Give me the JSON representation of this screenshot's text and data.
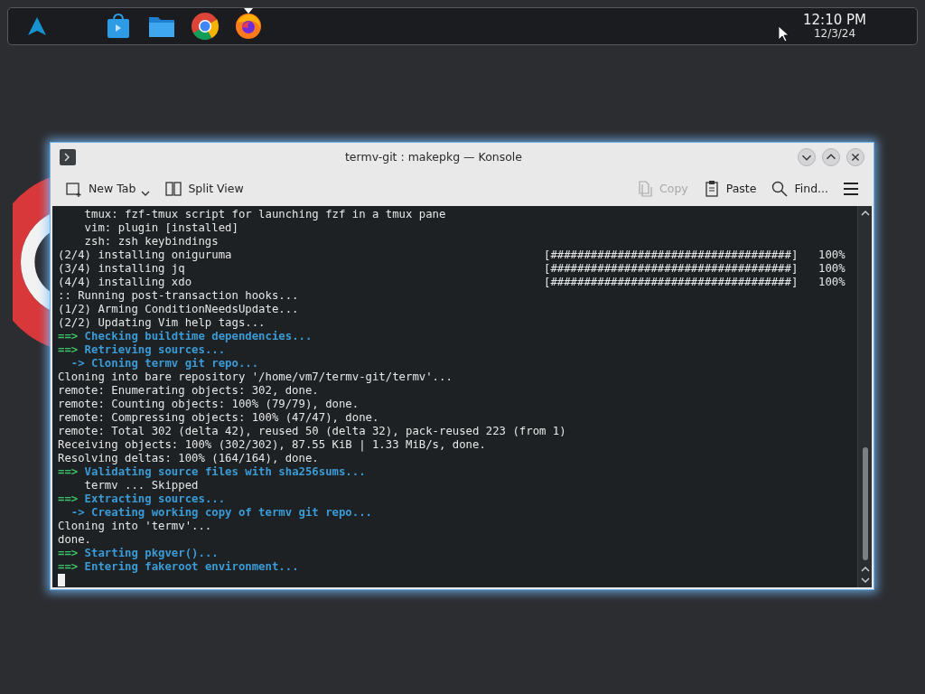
{
  "panel": {
    "launchers": [
      {
        "kind": "menu",
        "active": false
      },
      {
        "kind": "store",
        "active": false
      },
      {
        "kind": "files",
        "active": false
      },
      {
        "kind": "chrome",
        "active": false
      },
      {
        "kind": "firefox",
        "active": true
      }
    ],
    "clock": {
      "time": "12:10 PM",
      "date": "12/3/24"
    }
  },
  "window": {
    "title": "termv-git : makepkg — Konsole"
  },
  "toolbar": [
    {
      "kind": "newtab",
      "label": "New Tab",
      "disabled": false,
      "dropdown": true
    },
    {
      "kind": "split",
      "label": "Split View",
      "disabled": false
    },
    {
      "kind": "copy",
      "label": "Copy",
      "disabled": true
    },
    {
      "kind": "paste",
      "label": "Paste",
      "disabled": false
    },
    {
      "kind": "find",
      "label": "Find...",
      "disabled": false
    }
  ],
  "terminal": {
    "lines": [
      {
        "kind": "plain",
        "text": "    tmux: fzf-tmux script for launching fzf in a tmux pane"
      },
      {
        "kind": "plain",
        "text": "    vim: plugin [installed]"
      },
      {
        "kind": "plain",
        "text": "    zsh: zsh keybindings"
      },
      {
        "kind": "progress",
        "text": "(2/4) installing oniguruma",
        "bar": "[####################################]",
        "percent": "100%"
      },
      {
        "kind": "progress",
        "text": "(3/4) installing jq",
        "bar": "[####################################]",
        "percent": "100%"
      },
      {
        "kind": "progress",
        "text": "(4/4) installing xdo",
        "bar": "[####################################]",
        "percent": "100%"
      },
      {
        "kind": "plain",
        "text": ":: Running post-transaction hooks..."
      },
      {
        "kind": "plain",
        "text": "(1/2) Arming ConditionNeedsUpdate..."
      },
      {
        "kind": "plain",
        "text": "(2/2) Updating Vim help tags..."
      },
      {
        "kind": "step",
        "prefix": "==>",
        "text": "Checking buildtime dependencies..."
      },
      {
        "kind": "step",
        "prefix": "==>",
        "text": "Retrieving sources..."
      },
      {
        "kind": "substep",
        "prefix": "  ->",
        "text": "Cloning termv git repo..."
      },
      {
        "kind": "plain",
        "text": "Cloning into bare repository '/home/vm7/termv-git/termv'..."
      },
      {
        "kind": "plain",
        "text": "remote: Enumerating objects: 302, done."
      },
      {
        "kind": "plain",
        "text": "remote: Counting objects: 100% (79/79), done."
      },
      {
        "kind": "plain",
        "text": "remote: Compressing objects: 100% (47/47), done."
      },
      {
        "kind": "plain",
        "text": "remote: Total 302 (delta 42), reused 50 (delta 32), pack-reused 223 (from 1)"
      },
      {
        "kind": "plain",
        "text": "Receiving objects: 100% (302/302), 87.55 KiB | 1.33 MiB/s, done."
      },
      {
        "kind": "plain",
        "text": "Resolving deltas: 100% (164/164), done."
      },
      {
        "kind": "step",
        "prefix": "==>",
        "text": "Validating source files with sha256sums..."
      },
      {
        "kind": "plain",
        "text": "    termv ... Skipped"
      },
      {
        "kind": "step",
        "prefix": "==>",
        "text": "Extracting sources..."
      },
      {
        "kind": "substep",
        "prefix": "  ->",
        "text": "Creating working copy of termv git repo..."
      },
      {
        "kind": "plain",
        "text": "Cloning into 'termv'..."
      },
      {
        "kind": "plain",
        "text": "done."
      },
      {
        "kind": "step",
        "prefix": "==>",
        "text": "Starting pkgver()..."
      },
      {
        "kind": "step",
        "prefix": "==>",
        "text": "Entering fakeroot environment..."
      },
      {
        "kind": "cursor"
      }
    ]
  }
}
